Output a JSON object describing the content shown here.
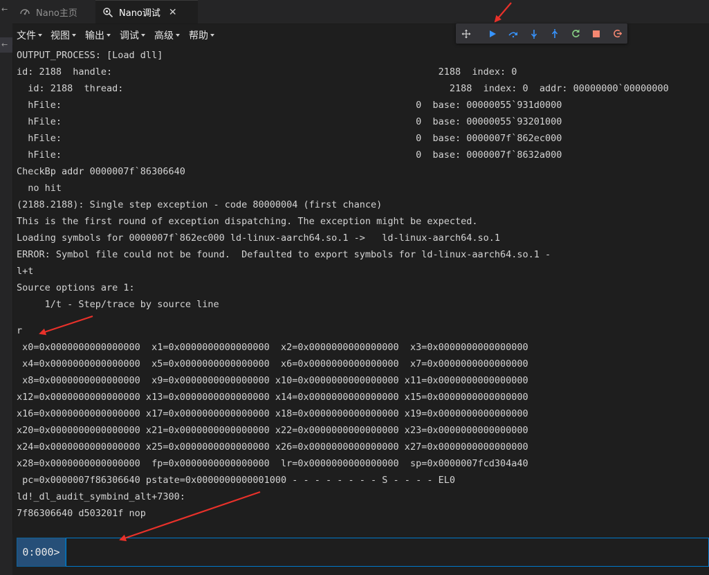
{
  "left_strip": {
    "char_top": "←",
    "char_mid": "←"
  },
  "tabs": [
    {
      "label": "Nano主页",
      "active": false
    },
    {
      "label": "Nano调试",
      "active": true,
      "close": "✕"
    }
  ],
  "menus": [
    "文件",
    "视图",
    "输出",
    "调试",
    "高级",
    "帮助"
  ],
  "debug_toolbar": [
    {
      "name": "drag-handle-icon",
      "color": "#cccccc"
    },
    {
      "name": "continue-icon",
      "color": "#3794ff"
    },
    {
      "name": "step-over-icon",
      "color": "#3794ff"
    },
    {
      "name": "step-into-icon",
      "color": "#3794ff"
    },
    {
      "name": "step-out-icon",
      "color": "#3794ff"
    },
    {
      "name": "restart-icon",
      "color": "#89d185"
    },
    {
      "name": "stop-icon",
      "color": "#f48771"
    },
    {
      "name": "disconnect-icon",
      "color": "#f48771"
    }
  ],
  "output_lines": [
    "OUTPUT_PROCESS: [Load dll]",
    "id: 2188  handle:                                                          2188  index: 0",
    "  id: 2188  thread:                                                          2188  index: 0  addr: 00000000`00000000",
    "  hFile:                                                               0  base: 00000055`931d0000",
    "  hFile:                                                               0  base: 00000055`93201000",
    "  hFile:                                                               0  base: 0000007f`862ec000",
    "  hFile:                                                               0  base: 0000007f`8632a000",
    "CheckBp addr 0000007f`86306640",
    "  no hit",
    "(2188.2188): Single step exception - code 80000004 (first chance)",
    "This is the first round of exception dispatching. The exception might be expected.",
    "Loading symbols for 0000007f`862ec000 ld-linux-aarch64.so.1 ->   ld-linux-aarch64.so.1",
    "ERROR: Symbol file could not be found.  Defaulted to export symbols for ld-linux-aarch64.so.1 -",
    "l+t",
    "Source options are 1:",
    "     1/t - Step/trace by source line",
    "",
    "r",
    " x0=0x0000000000000000  x1=0x0000000000000000  x2=0x0000000000000000  x3=0x0000000000000000",
    " x4=0x0000000000000000  x5=0x0000000000000000  x6=0x0000000000000000  x7=0x0000000000000000",
    " x8=0x0000000000000000  x9=0x0000000000000000 x10=0x0000000000000000 x11=0x0000000000000000",
    "x12=0x0000000000000000 x13=0x0000000000000000 x14=0x0000000000000000 x15=0x0000000000000000",
    "x16=0x0000000000000000 x17=0x0000000000000000 x18=0x0000000000000000 x19=0x0000000000000000",
    "x20=0x0000000000000000 x21=0x0000000000000000 x22=0x0000000000000000 x23=0x0000000000000000",
    "x24=0x0000000000000000 x25=0x0000000000000000 x26=0x0000000000000000 x27=0x0000000000000000",
    "x28=0x0000000000000000  fp=0x0000000000000000  lr=0x0000000000000000  sp=0x0000007fcd304a40",
    " pc=0x0000007f86306640 pstate=0x0000000000001000 - - - - - - - - S - - - - EL0",
    "ld!_dl_audit_symbind_alt+7300:",
    "7f86306640 d503201f nop"
  ],
  "command": {
    "prompt": "0:000>",
    "value": ""
  },
  "colors": {
    "accent": "#007acc",
    "prompt_bg": "#264f78",
    "arrow": "#e8312a"
  }
}
